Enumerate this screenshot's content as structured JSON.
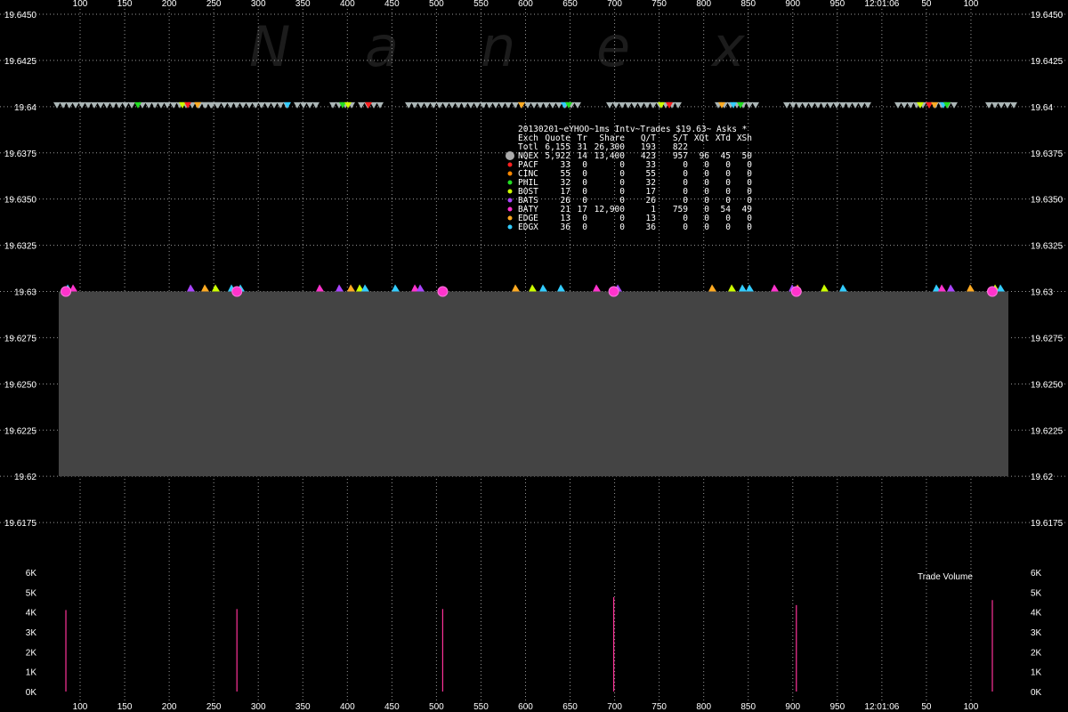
{
  "chart_data": [
    {
      "type": "scatter",
      "title": "20130201~eYHOO~1ms Intv~Trades $19.63~ Asks *",
      "watermark": [
        "N",
        "a",
        "n",
        "e",
        "x"
      ],
      "x_ticks": [
        "100",
        "150",
        "200",
        "250",
        "300",
        "350",
        "400",
        "450",
        "500",
        "550",
        "600",
        "650",
        "700",
        "750",
        "800",
        "850",
        "900",
        "950",
        "12:01:06",
        "50",
        "100"
      ],
      "x_tick_values": [
        100,
        150,
        200,
        250,
        300,
        350,
        400,
        450,
        500,
        550,
        600,
        650,
        700,
        750,
        800,
        850,
        900,
        950,
        1000,
        1050,
        1100
      ],
      "xlim": [
        76,
        1142
      ],
      "ylim": [
        19.615,
        19.645
      ],
      "y_ticks": [
        "19.6450",
        "19.6425",
        "19.64",
        "19.6375",
        "19.6350",
        "19.6325",
        "19.63",
        "19.6275",
        "19.6250",
        "19.6225",
        "19.62",
        "19.6175"
      ],
      "y_tick_values": [
        19.645,
        19.6425,
        19.64,
        19.6375,
        19.635,
        19.6325,
        19.63,
        19.6275,
        19.625,
        19.6225,
        19.62,
        19.6175
      ],
      "grid": true,
      "bid_ask_band": {
        "bid": 19.62,
        "ask": 19.63,
        "color": "#444444"
      },
      "ask_level": 19.64,
      "trade_price": 19.63,
      "trade_x": [
        100,
        292,
        523,
        715,
        920,
        1140
      ],
      "stats_header": [
        "Exch",
        "Quote",
        "Tr",
        "Share",
        "Q/T",
        "S/T",
        "XQt",
        "XTd",
        "XSh"
      ],
      "stats_rows": [
        {
          "exch": "Totl",
          "quote": "6,155",
          "tr": "31",
          "share": "26,300",
          "qt": "193",
          "st": "822",
          "xqt": "",
          "xtd": "",
          "xsh": "",
          "color": ""
        },
        {
          "exch": "NQEX",
          "quote": "5,922",
          "tr": "14",
          "share": "13,400",
          "qt": "423",
          "st": "957",
          "xqt": "96",
          "xtd": "45",
          "xsh": "50",
          "color": "#aaaaaa"
        },
        {
          "exch": "PACF",
          "quote": "33",
          "tr": "0",
          "share": "0",
          "qt": "33",
          "st": "0",
          "xqt": "0",
          "xtd": "0",
          "xsh": "0",
          "color": "#ff2020"
        },
        {
          "exch": "CINC",
          "quote": "55",
          "tr": "0",
          "share": "0",
          "qt": "55",
          "st": "0",
          "xqt": "0",
          "xtd": "0",
          "xsh": "0",
          "color": "#ff8800"
        },
        {
          "exch": "PHIL",
          "quote": "32",
          "tr": "0",
          "share": "0",
          "qt": "32",
          "st": "0",
          "xqt": "0",
          "xtd": "0",
          "xsh": "0",
          "color": "#22dd22"
        },
        {
          "exch": "BOST",
          "quote": "17",
          "tr": "0",
          "share": "0",
          "qt": "17",
          "st": "0",
          "xqt": "0",
          "xtd": "0",
          "xsh": "0",
          "color": "#ccff00"
        },
        {
          "exch": "BATS",
          "quote": "26",
          "tr": "0",
          "share": "0",
          "qt": "26",
          "st": "0",
          "xqt": "0",
          "xtd": "0",
          "xsh": "0",
          "color": "#aa44ff"
        },
        {
          "exch": "BATY",
          "quote": "21",
          "tr": "17",
          "share": "12,900",
          "qt": "1",
          "st": "759",
          "xqt": "0",
          "xtd": "54",
          "xsh": "49",
          "color": "#ff33cc"
        },
        {
          "exch": "EDGE",
          "quote": "13",
          "tr": "0",
          "share": "0",
          "qt": "13",
          "st": "0",
          "xqt": "0",
          "xtd": "0",
          "xsh": "0",
          "color": "#ffaa22"
        },
        {
          "exch": "EDGX",
          "quote": "36",
          "tr": "0",
          "share": "0",
          "qt": "36",
          "st": "0",
          "xqt": "0",
          "xtd": "0",
          "xsh": "0",
          "color": "#33ccff"
        }
      ]
    },
    {
      "type": "bar",
      "title": "Trade Volume",
      "y_ticks": [
        "6K",
        "5K",
        "4K",
        "3K",
        "2K",
        "1K",
        "0K"
      ],
      "y_tick_values": [
        6000,
        5000,
        4000,
        3000,
        2000,
        1000,
        0
      ],
      "ylim": [
        0,
        6000
      ],
      "x": [
        100,
        292,
        523,
        715,
        920,
        1140
      ],
      "values": [
        4100,
        4150,
        4150,
        4750,
        4350,
        4600
      ],
      "color": "#ff3399"
    }
  ]
}
